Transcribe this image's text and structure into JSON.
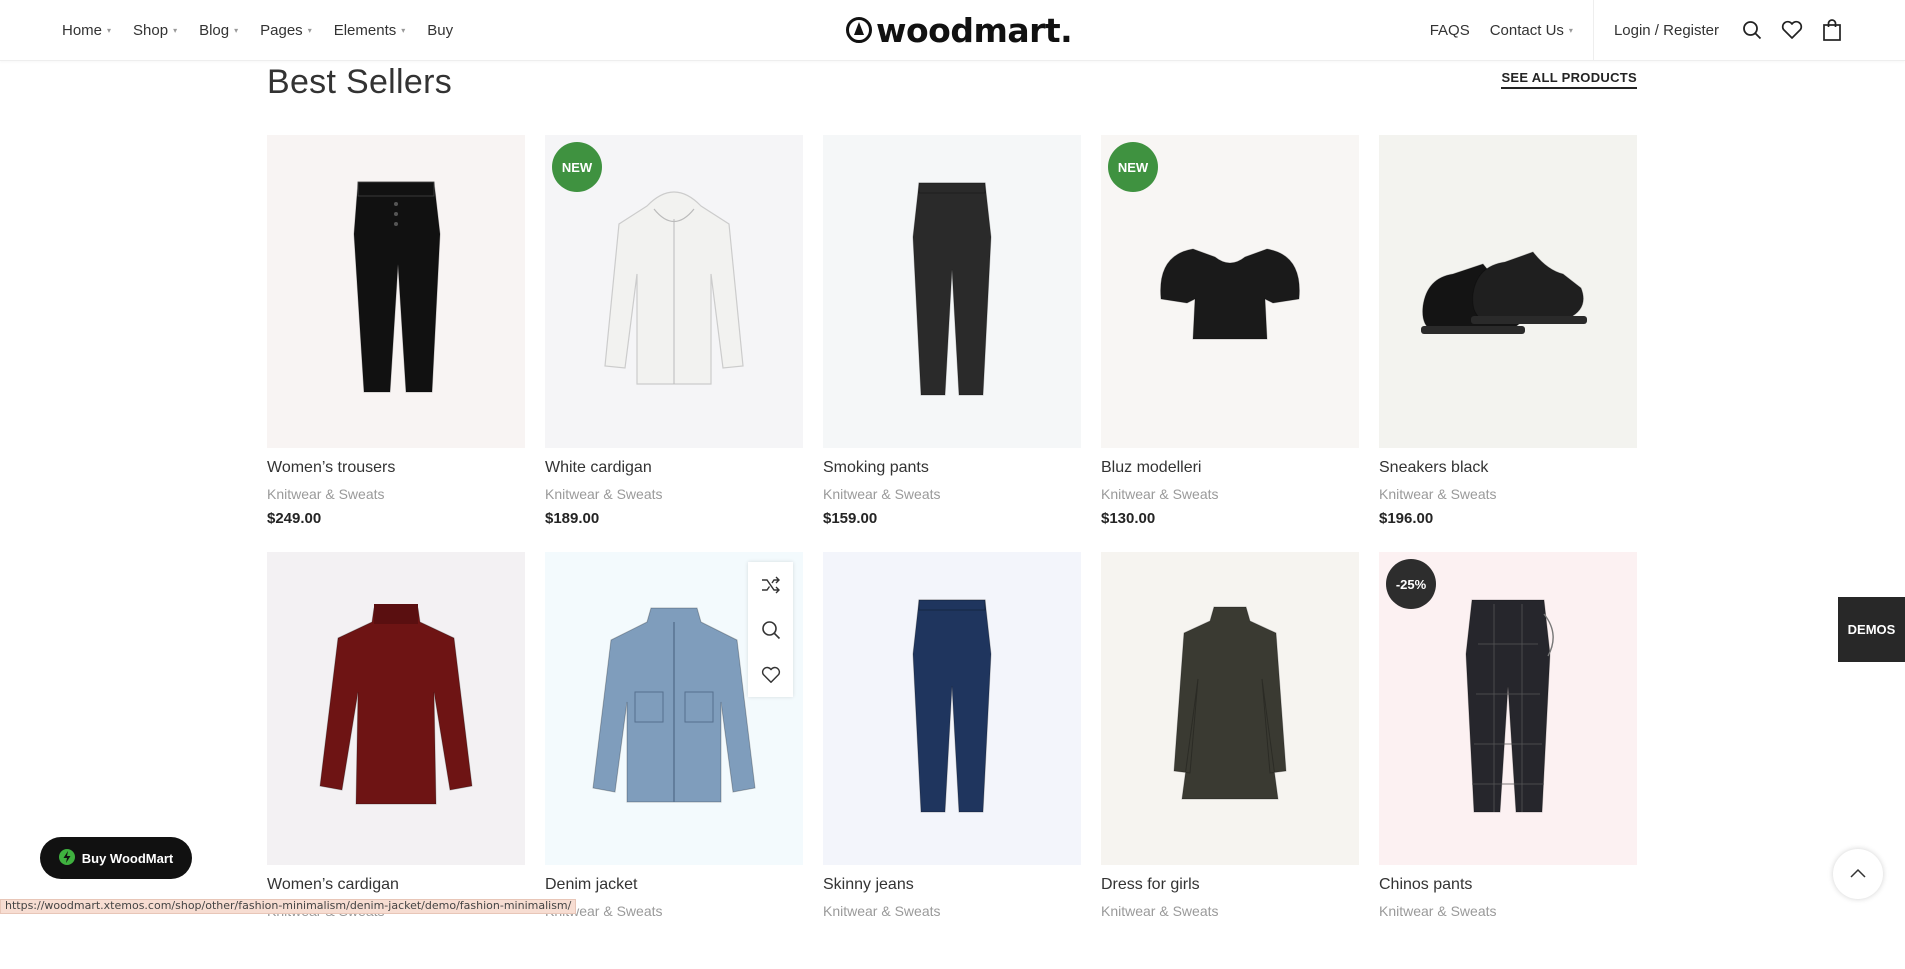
{
  "header": {
    "nav_left": [
      {
        "label": "Home",
        "caret": true
      },
      {
        "label": "Shop",
        "caret": true
      },
      {
        "label": "Blog",
        "caret": true
      },
      {
        "label": "Pages",
        "caret": true
      },
      {
        "label": "Elements",
        "caret": true
      },
      {
        "label": "Buy",
        "caret": false
      }
    ],
    "logo_text": "woodmart.",
    "nav_right": [
      {
        "label": "FAQS",
        "caret": false
      },
      {
        "label": "Contact Us",
        "caret": true
      }
    ],
    "login_label": "Login / Register",
    "icons": [
      "search-icon",
      "heart-icon",
      "shopping-bag-icon"
    ]
  },
  "section": {
    "title": "Best Sellers",
    "see_all_label": "SEE ALL PRODUCTS"
  },
  "products": [
    {
      "name": "Women’s trousers",
      "category": "Knitwear & Sweats",
      "price": "$249.00",
      "badge": "",
      "bg": "#f8f4f3",
      "item": "trousers",
      "color": "#111111"
    },
    {
      "name": "White cardigan",
      "category": "Knitwear & Sweats",
      "price": "$189.00",
      "badge": "NEW",
      "bg": "#f5f5f7",
      "item": "hoodie",
      "color": "#f2f2f0"
    },
    {
      "name": "Smoking pants",
      "category": "Knitwear & Sweats",
      "price": "$159.00",
      "badge": "",
      "bg": "#f5f7f8",
      "item": "jeans",
      "color": "#2a2a2a"
    },
    {
      "name": "Bluz modelleri",
      "category": "Knitwear & Sweats",
      "price": "$130.00",
      "badge": "NEW",
      "bg": "#f8f6f4",
      "item": "croptop",
      "color": "#1a1a1a"
    },
    {
      "name": "Sneakers black",
      "category": "Knitwear & Sweats",
      "price": "$196.00",
      "badge": "",
      "bg": "#f3f3ef",
      "item": "sneakers",
      "color": "#141414"
    },
    {
      "name": "Women’s cardigan",
      "category": "Knitwear & Sweats",
      "price": "",
      "badge": "",
      "bg": "#f3f1f3",
      "item": "sweater",
      "color": "#6e1414"
    },
    {
      "name": "Denim jacket",
      "category": "Knitwear & Sweats",
      "price": "",
      "badge": "",
      "bg": "#f3fafd",
      "item": "jacket",
      "color": "#7f9dbc",
      "hover_actions": [
        "shuffle-icon",
        "zoom-icon",
        "heart-icon"
      ]
    },
    {
      "name": "Skinny jeans",
      "category": "Knitwear & Sweats",
      "price": "",
      "badge": "",
      "bg": "#f3f5fb",
      "item": "jeans",
      "color": "#1f355e"
    },
    {
      "name": "Dress for girls",
      "category": "Knitwear & Sweats",
      "price": "",
      "badge": "",
      "bg": "#f6f4f0",
      "item": "dress",
      "color": "#3a3a32"
    },
    {
      "name": "Chinos pants",
      "category": "Knitwear & Sweats",
      "price": "",
      "badge": "-25%",
      "bg": "#fcf1f2",
      "item": "chinos",
      "color": "#26262c"
    }
  ],
  "badge_colors": {
    "NEW": "#3f9240",
    "-25%": "#2d2d2d"
  },
  "floating": {
    "buy_label": "Buy WoodMart",
    "demos_label": "DEMOS",
    "status_url": "https://woodmart.xtemos.com/shop/other/fashion-minimalism/denim-jacket/demo/fashion-minimalism/"
  }
}
